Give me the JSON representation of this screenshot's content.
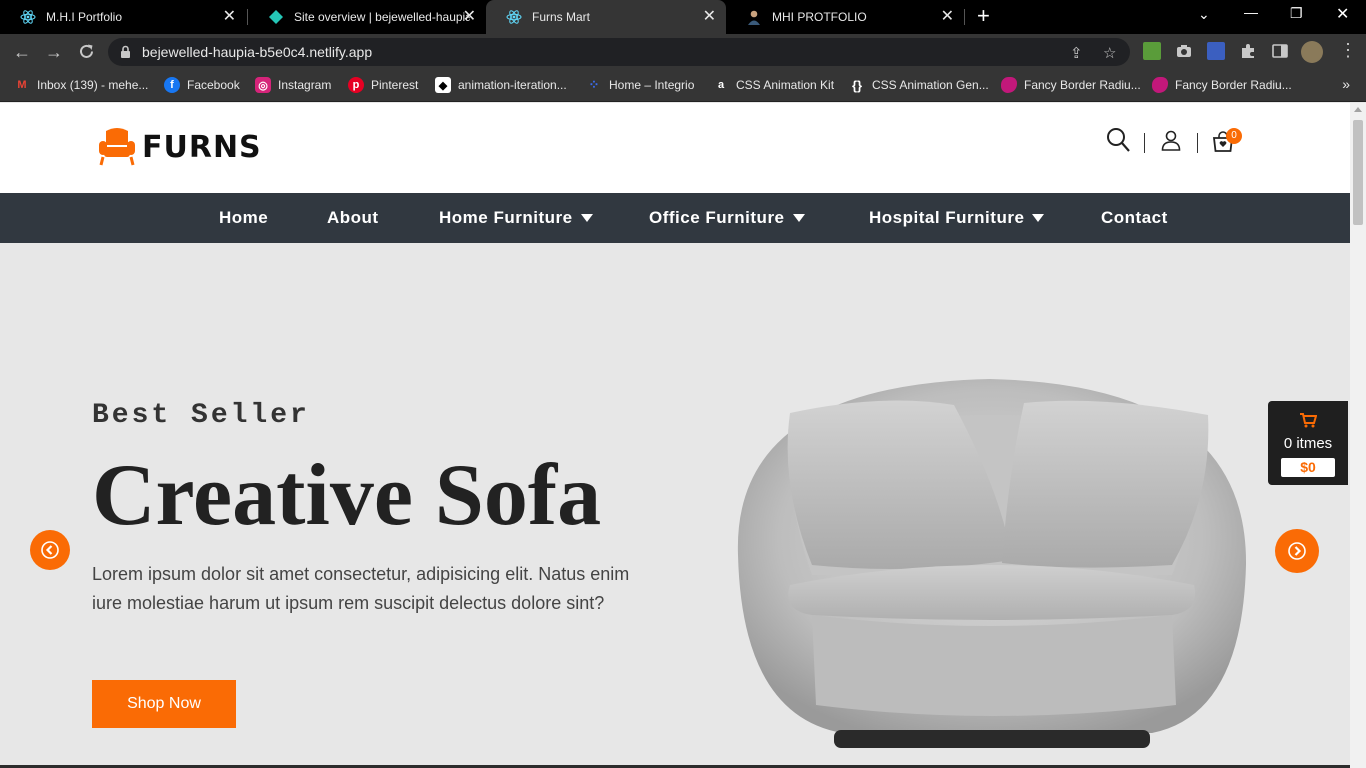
{
  "browser": {
    "tabs": [
      {
        "title": "M.H.I Portfolio",
        "icon": "react-icon",
        "active": false
      },
      {
        "title": "Site overview | bejewelled-haupia",
        "icon": "netlify-icon",
        "active": false
      },
      {
        "title": "Furns Mart",
        "icon": "react-icon",
        "active": true
      },
      {
        "title": "MHI PROTFOLIO",
        "icon": "avatar-icon",
        "active": false
      }
    ],
    "url": "bejewelled-haupia-b5e0c4.netlify.app",
    "bookmarks": [
      {
        "label": "Inbox (139) - mehe...",
        "icon": "gmail-icon"
      },
      {
        "label": "Facebook",
        "icon": "facebook-icon"
      },
      {
        "label": "Instagram",
        "icon": "instagram-icon"
      },
      {
        "label": "Pinterest",
        "icon": "pinterest-icon"
      },
      {
        "label": "animation-iteration...",
        "icon": "codepen-icon"
      },
      {
        "label": "Home – Integrio",
        "icon": "integrio-icon"
      },
      {
        "label": "CSS Animation Kit",
        "icon": "animation-kit-icon"
      },
      {
        "label": "CSS Animation Gen...",
        "icon": "braces-icon"
      },
      {
        "label": "Fancy Border Radiu...",
        "icon": "blob-icon"
      },
      {
        "label": "Fancy Border Radiu...",
        "icon": "blob-icon"
      }
    ],
    "colors": {
      "tabbar": "#000000",
      "toolbar": "#353535",
      "omnibox": "#202124"
    }
  },
  "site": {
    "logo_text": "FURNS",
    "cart_count": "0",
    "nav": [
      {
        "label": "Home",
        "dropdown": false
      },
      {
        "label": "About",
        "dropdown": false
      },
      {
        "label": "Home Furniture",
        "dropdown": true
      },
      {
        "label": "Office Furniture",
        "dropdown": true
      },
      {
        "label": "Hospital Furniture",
        "dropdown": true
      },
      {
        "label": "Contact",
        "dropdown": false
      }
    ],
    "hero": {
      "subtitle": "Best Seller",
      "title": "Creative Sofa",
      "description": "Lorem ipsum dolor sit amet consectetur, adipisicing elit. Natus enim iure molestiae harum ut ipsum rem suscipit delectus dolore sint?",
      "button": "Shop Now"
    },
    "mini_cart": {
      "items": "0 itmes",
      "total": "$0"
    },
    "colors": {
      "accent": "#fa6b05",
      "nav_bg": "#313840",
      "hero_bg": "#e7e7e7"
    }
  }
}
